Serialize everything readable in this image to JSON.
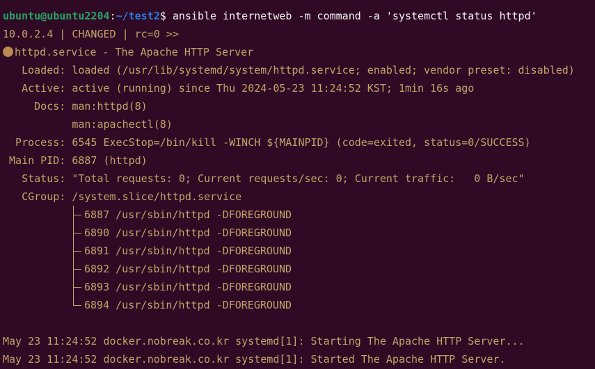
{
  "prompt": {
    "user_host": "ubuntu@ubuntu2204",
    "separator": ":",
    "path": "~/test2",
    "symbol": "$",
    "command": " ansible internetweb -m command -a 'systemctl status httpd'"
  },
  "result_header": "10.0.2.4 | CHANGED | rc=0 >>",
  "service": {
    "title": "httpd.service - The Apache HTTP Server",
    "loaded": "   Loaded: loaded (/usr/lib/systemd/system/httpd.service; enabled; vendor preset: disabled)",
    "active": "   Active: active (running) since Thu 2024-05-23 11:24:52 KST; 1min 16s ago",
    "docs": "     Docs: man:httpd(8)",
    "docs2": "           man:apachectl(8)",
    "process": "  Process: 6545 ExecStop=/bin/kill -WINCH ${MAINPID} (code=exited, status=0/SUCCESS)",
    "main_pid": " Main PID: 6887 (httpd)",
    "status": "   Status: \"Total requests: 0; Current requests/sec: 0; Current traffic:   0 B/sec\"",
    "cgroup": "   CGroup: /system.slice/httpd.service",
    "processes": [
      "6887 /usr/sbin/httpd -DFOREGROUND",
      "6890 /usr/sbin/httpd -DFOREGROUND",
      "6891 /usr/sbin/httpd -DFOREGROUND",
      "6892 /usr/sbin/httpd -DFOREGROUND",
      "6893 /usr/sbin/httpd -DFOREGROUND",
      "6894 /usr/sbin/httpd -DFOREGROUND"
    ]
  },
  "logs": [
    "May 23 11:24:52 docker.nobreak.co.kr systemd[1]: Starting The Apache HTTP Server...",
    "May 23 11:24:52 docker.nobreak.co.kr systemd[1]: Started The Apache HTTP Server."
  ]
}
